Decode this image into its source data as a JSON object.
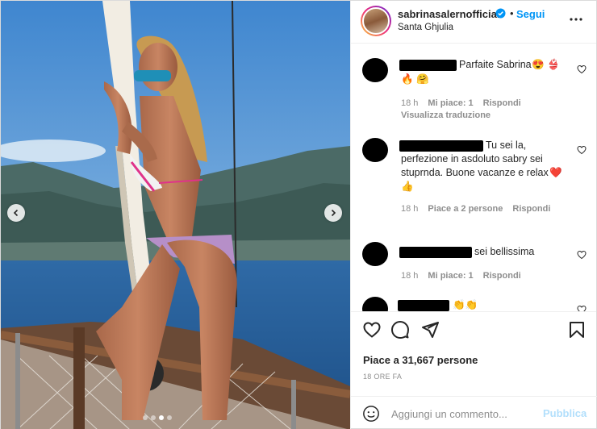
{
  "post": {
    "username": "sabrinasalernofficial",
    "follow_separator": "•",
    "follow_label": "Segui",
    "location": "Santa Ghjulia",
    "likes_text": "Piace a 31,667 persone",
    "time_ago": "18 ORE FA"
  },
  "comments": [
    {
      "text": "Parfaite Sabrina",
      "emoji_line": "🔥 🤗",
      "emoji_inline": "😍 👙",
      "time": "18 h",
      "likes": "Mi piace: 1",
      "reply": "Rispondi",
      "translate": "Visualizza traduzione"
    },
    {
      "text_line1": "Tu sei la,",
      "text_line2": "perfezione in asdoluto sabry sei",
      "text_line3": "stuprnda. Buone vacanze e relax",
      "heart_emoji": "❤️",
      "emoji_line": "👍",
      "time": "18 h",
      "likes": "Piace a 2 persone",
      "reply": "Rispondi"
    },
    {
      "text": "sei bellissima",
      "time": "18 h",
      "likes": "Mi piace: 1",
      "reply": "Rispondi"
    },
    {
      "text": "👏👏"
    }
  ],
  "composer": {
    "placeholder": "Aggiungi un commento...",
    "publish_label": "Pubblica"
  },
  "carousel": {
    "current_index": 3,
    "total": 4
  },
  "icons": {
    "header": [
      "verified-badge-icon",
      "more-options-icon"
    ],
    "actions": [
      "heart-icon",
      "comment-icon",
      "share-icon",
      "bookmark-icon"
    ],
    "composer": [
      "emoji-icon"
    ],
    "carousel": [
      "chevron-left-icon",
      "chevron-right-icon"
    ]
  },
  "colors": {
    "accent_blue": "#0095f6",
    "publish_disabled": "#b2dffc",
    "meta_gray": "#8e8e8e",
    "text_dark": "#262626"
  }
}
